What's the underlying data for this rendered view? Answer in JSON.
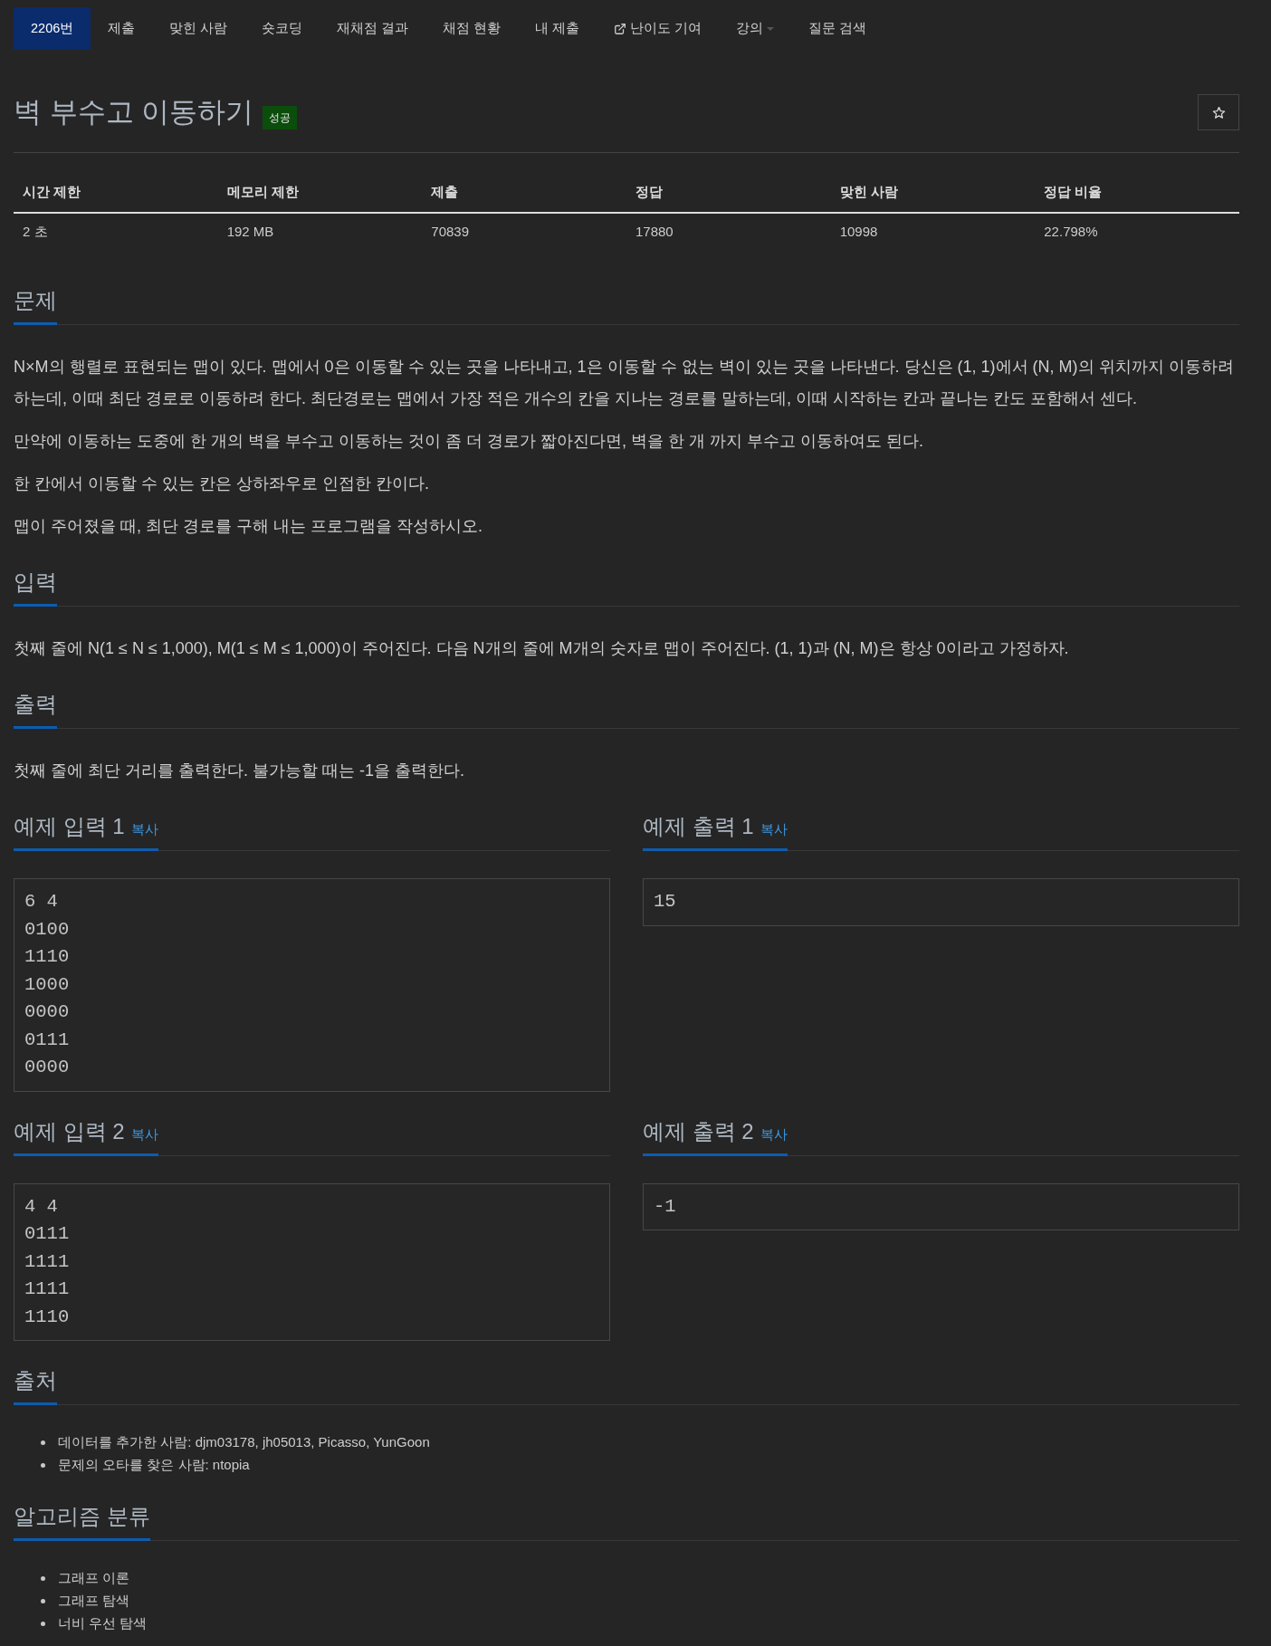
{
  "nav": {
    "items": [
      {
        "label": "2206번",
        "kind": "plain",
        "selected": true
      },
      {
        "label": "제출",
        "kind": "plain",
        "selected": false
      },
      {
        "label": "맞힌 사람",
        "kind": "plain",
        "selected": false
      },
      {
        "label": "숏코딩",
        "kind": "plain",
        "selected": false
      },
      {
        "label": "재채점 결과",
        "kind": "plain",
        "selected": false
      },
      {
        "label": "채점 현황",
        "kind": "plain",
        "selected": false
      },
      {
        "label": "내 제출",
        "kind": "plain",
        "selected": false
      },
      {
        "label": "난이도 기여",
        "kind": "external",
        "selected": false
      },
      {
        "label": "강의",
        "kind": "dropdown",
        "selected": false
      },
      {
        "label": "질문 검색",
        "kind": "plain",
        "selected": false
      }
    ]
  },
  "problem": {
    "title": "벽 부수고 이동하기",
    "badge": "성공"
  },
  "info_table": {
    "columns": [
      "시간 제한",
      "메모리 제한",
      "제출",
      "정답",
      "맞힌 사람",
      "정답 비율"
    ],
    "rows": [
      [
        "2 초",
        "192 MB",
        "70839",
        "17880",
        "10998",
        "22.798%"
      ]
    ]
  },
  "description": {
    "heading": "문제",
    "paragraphs": [
      "N×M의 행렬로 표현되는 맵이 있다. 맵에서 0은 이동할 수 있는 곳을 나타내고, 1은 이동할 수 없는 벽이 있는 곳을 나타낸다. 당신은 (1, 1)에서 (N, M)의 위치까지 이동하려 하는데, 이때 최단 경로로 이동하려 한다. 최단경로는 맵에서 가장 적은 개수의 칸을 지나는 경로를 말하는데, 이때 시작하는 칸과 끝나는 칸도 포함해서 센다.",
      "만약에 이동하는 도중에 한 개의 벽을 부수고 이동하는 것이 좀 더 경로가 짧아진다면, 벽을 한 개 까지 부수고 이동하여도 된다.",
      "한 칸에서 이동할 수 있는 칸은 상하좌우로 인접한 칸이다.",
      "맵이 주어졌을 때, 최단 경로를 구해 내는 프로그램을 작성하시오."
    ]
  },
  "input": {
    "heading": "입력",
    "paragraphs": [
      "첫째 줄에 N(1 ≤ N ≤ 1,000), M(1 ≤ M ≤ 1,000)이 주어진다. 다음 N개의 줄에 M개의 숫자로 맵이 주어진다. (1, 1)과 (N, M)은 항상 0이라고 가정하자."
    ]
  },
  "output": {
    "heading": "출력",
    "paragraphs": [
      "첫째 줄에 최단 거리를 출력한다. 불가능할 때는 -1을 출력한다."
    ]
  },
  "samples": [
    {
      "input": {
        "heading": "예제 입력 1",
        "copy_link": "복사",
        "text": "6 4\n0100\n1110\n1000\n0000\n0111\n0000"
      },
      "output": {
        "heading": "예제 출력 1",
        "copy_link": "복사",
        "text": "15"
      }
    },
    {
      "input": {
        "heading": "예제 입력 2",
        "copy_link": "복사",
        "text": "4 4\n0111\n1111\n1111\n1110"
      },
      "output": {
        "heading": "예제 출력 2",
        "copy_link": "복사",
        "text": "-1"
      }
    }
  ],
  "source": {
    "heading": "출처",
    "items": [
      "데이터를 추가한 사람: djm03178, jh05013, Picasso, YunGoon",
      "문제의 오타를 찾은 사람: ntopia"
    ]
  },
  "tags": {
    "heading": "알고리즘 분류",
    "items": [
      "그래프 이론",
      "그래프 탐색",
      "너비 우선 탐색"
    ]
  }
}
